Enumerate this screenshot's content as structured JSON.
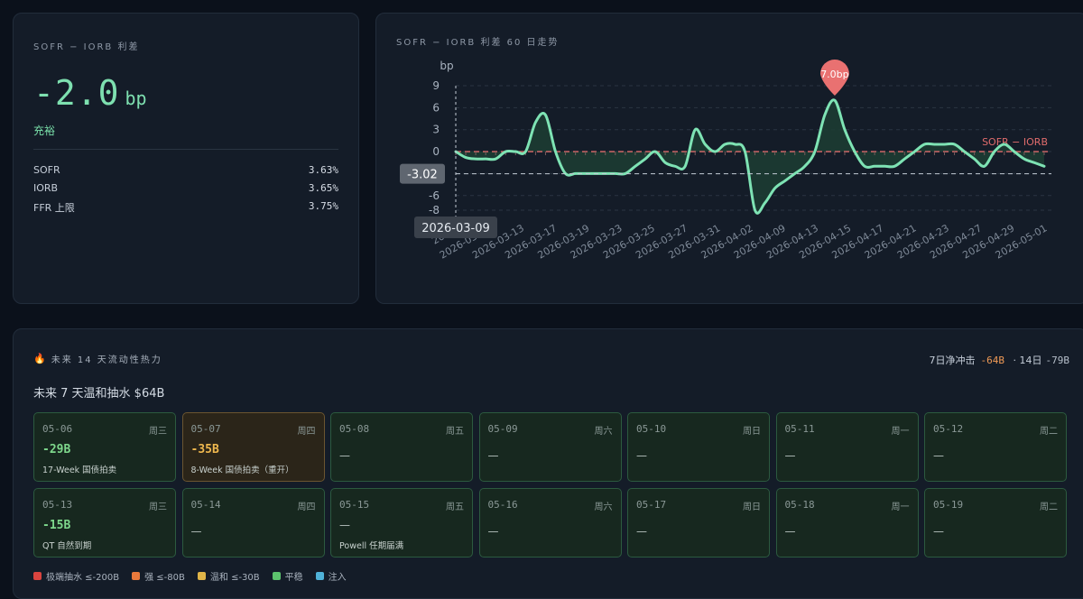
{
  "spread_card": {
    "title": "SOFR − IORB 利差",
    "value": "-2.0",
    "unit": "bp",
    "status": "充裕",
    "rates": [
      {
        "label": "SOFR",
        "value": "3.63%"
      },
      {
        "label": "IORB",
        "value": "3.65%"
      },
      {
        "label": "FFR 上限",
        "value": "3.75%"
      }
    ]
  },
  "chart_card": {
    "title": "SOFR − IORB 利差 60 日走势",
    "tooltip_value": "-3.02",
    "tooltip_date": "2026-03-09",
    "peak_label": "7.0bp",
    "reference_label": "SOFR − IORB"
  },
  "chart_data": {
    "type": "line",
    "title": "SOFR − IORB 利差 60 日走势",
    "ylabel": "bp",
    "ylim": [
      -9,
      10
    ],
    "yticks": [
      9,
      6,
      3,
      0,
      -3,
      -6,
      -8
    ],
    "x_tick_labels": [
      "2026-03-09",
      "2026-03-11",
      "2026-03-13",
      "2026-03-17",
      "2026-03-19",
      "2026-03-23",
      "2026-03-25",
      "2026-03-27",
      "2026-03-31",
      "2026-04-02",
      "2026-04-09",
      "2026-04-13",
      "2026-04-15",
      "2026-04-17",
      "2026-04-21",
      "2026-04-23",
      "2026-04-27",
      "2026-04-29",
      "2026-05-01"
    ],
    "x_visible_labels": [
      "2026-",
      "2026-03-11",
      "2026-03-13",
      "2026-03-17",
      "2026-03-19",
      "2026-03-23",
      "2026-03-25",
      "2026-03-27",
      "2026-03-31",
      "2026-04-02",
      "2026-04-09",
      "2026-04-13",
      "2026-04-15",
      "2026-04-17",
      "2026-04-21",
      "2026-04-23",
      "2026-04-27",
      "2026-04-29",
      "2026-05-01"
    ],
    "x": [
      0,
      1,
      2,
      3,
      4,
      5,
      6,
      7,
      8,
      9,
      10,
      11,
      12,
      13,
      14,
      15,
      16,
      17,
      18,
      19,
      20,
      21,
      22,
      23,
      24,
      25,
      26,
      27,
      28,
      29,
      30,
      31,
      32,
      33,
      34,
      35,
      36,
      37,
      38,
      39,
      40,
      41,
      42,
      43,
      44,
      45,
      46,
      47,
      48,
      49,
      50,
      51,
      52,
      53,
      54,
      55,
      56,
      57,
      58,
      59
    ],
    "series": [
      {
        "color": "#7ee3b4",
        "values": [
          0,
          -0.8,
          -1,
          -1,
          -1,
          0,
          0,
          0,
          4,
          5,
          0,
          -3,
          -3,
          -3,
          -3,
          -3,
          -3,
          -3,
          -2,
          -1,
          0,
          -1.5,
          -2,
          -2,
          3,
          1,
          0,
          1,
          1,
          0,
          -8,
          -7,
          -5,
          -4,
          -3,
          -2,
          0,
          5,
          7,
          3,
          0,
          -2,
          -2,
          -2,
          -2,
          -1,
          0,
          1,
          1,
          1,
          1,
          0,
          -1,
          -2,
          0,
          1,
          0,
          -1,
          -1.5,
          -2
        ],
        "fill_color": "#1c3d33"
      }
    ],
    "reference_line": {
      "y": 0,
      "label": "SOFR − IORB",
      "color": "#e06c6c"
    },
    "cursor_line": {
      "y": -3.02,
      "x_index": 0
    },
    "peak": {
      "x_index": 38,
      "y": 7.0
    },
    "grid": true
  },
  "heat_card": {
    "title": "未来 14 天流动性热力",
    "icon": "fire-icon",
    "impact_label": "7日净冲击",
    "impact_7d": "-64B",
    "impact_14d_label": "· 14日",
    "impact_14d": "-79B",
    "subtitle": "未来 7 天温和抽水 $64B",
    "days": [
      {
        "date": "05-06",
        "weekday": "周三",
        "amount": "-29B",
        "desc": "17-Week 国债拍卖",
        "level": "ok"
      },
      {
        "date": "05-07",
        "weekday": "周四",
        "amount": "-35B",
        "desc": "8-Week 国债拍卖（重开）",
        "level": "warn"
      },
      {
        "date": "05-08",
        "weekday": "周五",
        "amount": "",
        "desc": "",
        "level": "ok"
      },
      {
        "date": "05-09",
        "weekday": "周六",
        "amount": "",
        "desc": "",
        "level": "ok"
      },
      {
        "date": "05-10",
        "weekday": "周日",
        "amount": "",
        "desc": "",
        "level": "ok"
      },
      {
        "date": "05-11",
        "weekday": "周一",
        "amount": "",
        "desc": "",
        "level": "ok"
      },
      {
        "date": "05-12",
        "weekday": "周二",
        "amount": "",
        "desc": "",
        "level": "ok"
      },
      {
        "date": "05-13",
        "weekday": "周三",
        "amount": "-15B",
        "desc": "QT 自然到期",
        "level": "ok"
      },
      {
        "date": "05-14",
        "weekday": "周四",
        "amount": "",
        "desc": "",
        "level": "ok"
      },
      {
        "date": "05-15",
        "weekday": "周五",
        "amount": "",
        "desc": "Powell 任期届满",
        "level": "ok"
      },
      {
        "date": "05-16",
        "weekday": "周六",
        "amount": "",
        "desc": "",
        "level": "ok"
      },
      {
        "date": "05-17",
        "weekday": "周日",
        "amount": "",
        "desc": "",
        "level": "ok"
      },
      {
        "date": "05-18",
        "weekday": "周一",
        "amount": "",
        "desc": "",
        "level": "ok"
      },
      {
        "date": "05-19",
        "weekday": "周二",
        "amount": "",
        "desc": "",
        "level": "ok"
      }
    ],
    "empty_mark": "—",
    "legend": [
      {
        "label": "极端抽水 ≤-200B",
        "color": "#d9443f"
      },
      {
        "label": "强 ≤-80B",
        "color": "#e8793c"
      },
      {
        "label": "温和 ≤-30B",
        "color": "#e0b548"
      },
      {
        "label": "平稳",
        "color": "#5cc26d"
      },
      {
        "label": "注入",
        "color": "#4fb2d8"
      }
    ]
  }
}
